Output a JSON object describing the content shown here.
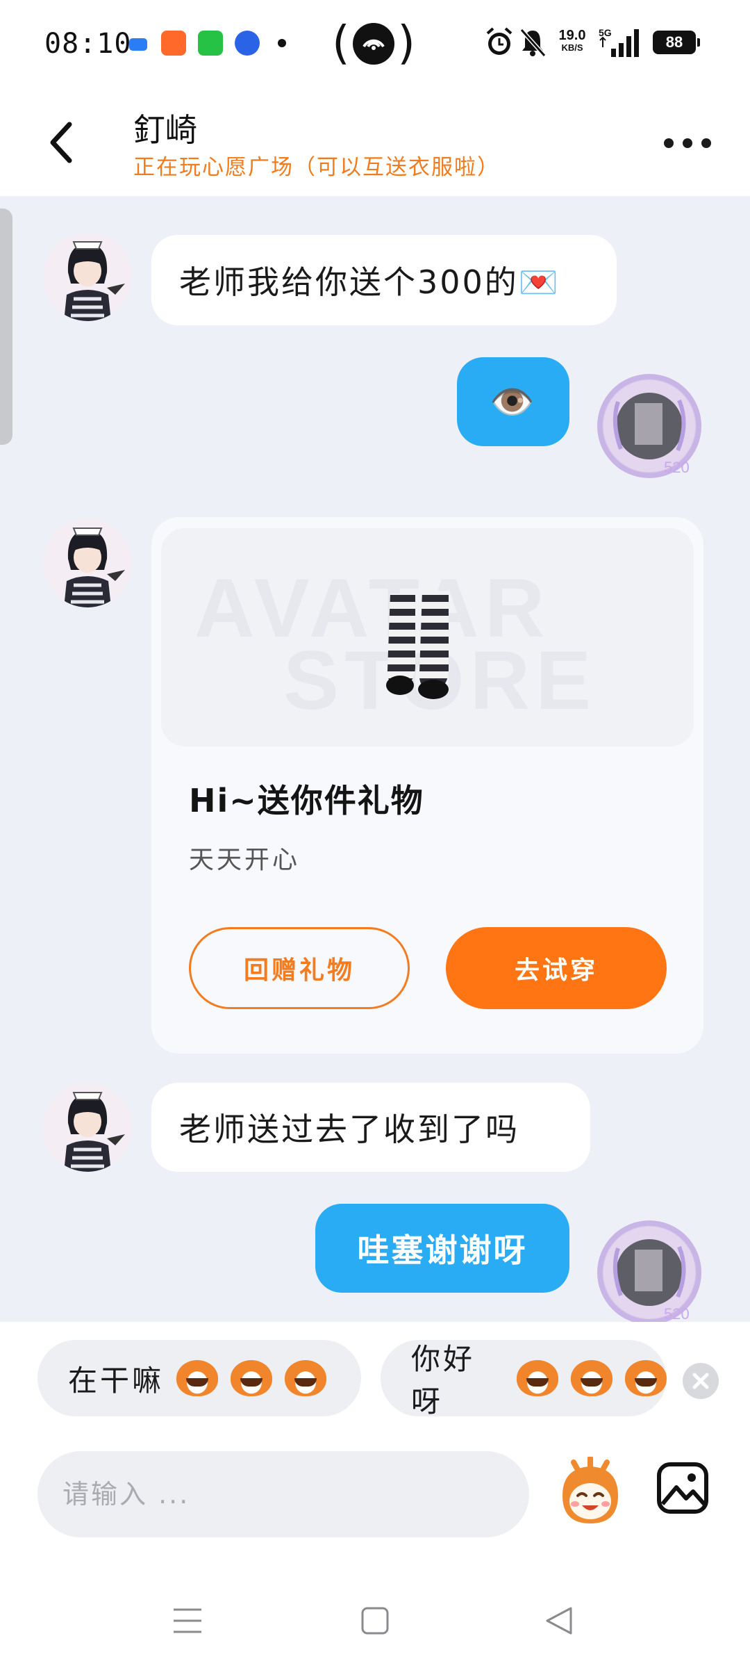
{
  "status_bar": {
    "time": "08:10",
    "net_speed": "19.0",
    "net_unit": "KB/S",
    "network": "5G",
    "battery": "88"
  },
  "header": {
    "contact_name": "釘崎",
    "contact_status": "正在玩心愿广场（可以互送衣服啦）"
  },
  "messages": {
    "m1": "老师我给你送个300的💌",
    "m2": "👁️",
    "m4": "老师送过去了收到了吗",
    "m5": "哇塞谢谢呀"
  },
  "gift_card": {
    "watermark_line1": "AVATAR",
    "watermark_line2": "STORE",
    "title": "Hi~送你件礼物",
    "subtitle": "天天开心",
    "return_gift_label": "回赠礼物",
    "try_on_label": "去试穿"
  },
  "quick_replies": [
    {
      "label": "在干嘛"
    },
    {
      "label": "你好呀"
    }
  ],
  "input": {
    "placeholder": "请输入 ...",
    "value": ""
  },
  "colors": {
    "accent_orange": "#ff7514",
    "bubble_blue": "#2aacf4",
    "chat_background": "#eef0f7"
  },
  "icons": {
    "back": "back-chevron-icon",
    "more": "more-dots-icon",
    "emoji": "sticker-face-icon",
    "image": "image-icon",
    "close": "close-icon",
    "nav_menu": "menu-icon",
    "nav_home": "home-icon",
    "nav_back": "back-triangle-icon"
  }
}
